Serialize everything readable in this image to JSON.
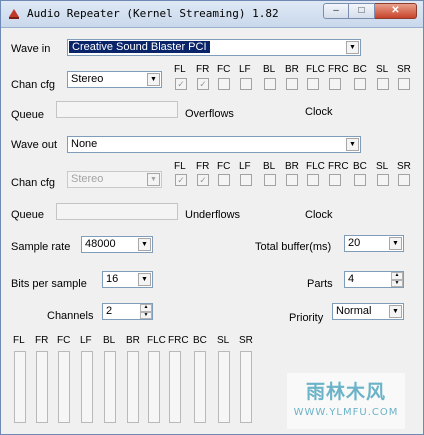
{
  "window": {
    "title": "Audio Repeater (Kernel Streaming) 1.82",
    "icon": "app-icon",
    "buttons": {
      "minimize": "–",
      "maximize": "□",
      "close": "✕"
    }
  },
  "input": {
    "wave_label": "Wave in",
    "wave_value": "Creative Sound Blaster PCI",
    "chan_cfg_label": "Chan cfg",
    "chan_cfg_value": "Stereo",
    "queue_label": "Queue",
    "overflows_label": "Overflows",
    "clock_label": "Clock"
  },
  "output": {
    "wave_label": "Wave out",
    "wave_value": "None",
    "chan_cfg_label": "Chan cfg",
    "chan_cfg_value": "Stereo",
    "queue_label": "Queue",
    "underflows_label": "Underflows",
    "clock_label": "Clock"
  },
  "channels": [
    "FL",
    "FR",
    "FC",
    "LF",
    "BL",
    "BR",
    "FLC",
    "FRC",
    "BC",
    "SL",
    "SR"
  ],
  "channel_checked": [
    true,
    true,
    false,
    false,
    false,
    false,
    false,
    false,
    false,
    false,
    false
  ],
  "settings": {
    "sample_rate_label": "Sample rate",
    "sample_rate_value": "48000",
    "total_buffer_label": "Total buffer(ms)",
    "total_buffer_value": "20",
    "bits_label": "Bits per sample",
    "bits_value": "16",
    "parts_label": "Parts",
    "parts_value": "4",
    "channels_label": "Channels",
    "channels_value": "2",
    "priority_label": "Priority",
    "priority_value": "Normal"
  },
  "meters": {
    "labels": [
      "FL",
      "FR",
      "FC",
      "LF",
      "BL",
      "BR",
      "FLC",
      "FRC",
      "BC",
      "SL",
      "SR"
    ],
    "levels": [
      0,
      0,
      0,
      0,
      0,
      0,
      0,
      0,
      0,
      0,
      0
    ]
  },
  "watermark": {
    "main": "雨林木风",
    "sub": "WWW.YLMFU.COM"
  }
}
